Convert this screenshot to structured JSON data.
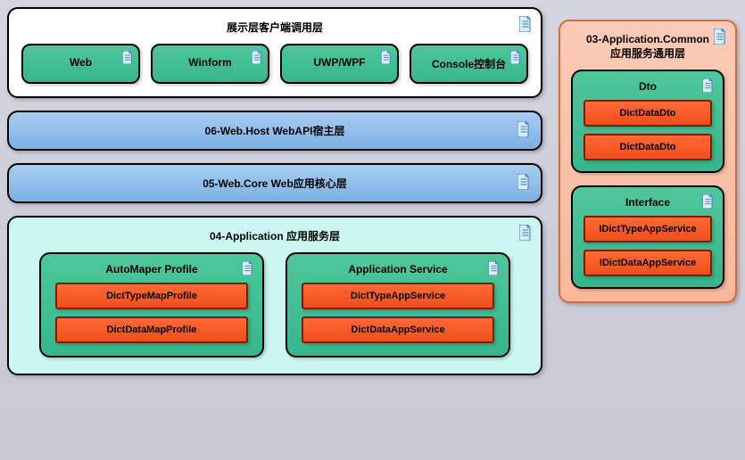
{
  "presentation": {
    "title": "展示层客户端调用层",
    "items": [
      {
        "label": "Web"
      },
      {
        "label": "Winform"
      },
      {
        "label": "UWP/WPF"
      },
      {
        "label": "Console控制台"
      }
    ]
  },
  "webHost": {
    "title": "06-Web.Host WebAPI宿主层"
  },
  "webCore": {
    "title": "05-Web.Core Web应用核心层"
  },
  "application": {
    "title": "04-Application 应用服务层",
    "automapper": {
      "title": "AutoMaper Profile",
      "items": [
        {
          "label": "DictTypeMapProfile"
        },
        {
          "label": "DictDataMapProfile"
        }
      ]
    },
    "service": {
      "title": "Application Service",
      "items": [
        {
          "label": "DictTypeAppService"
        },
        {
          "label": "DictDataAppService"
        }
      ]
    }
  },
  "common": {
    "title_line1": "03-Application.Common",
    "title_line2": "应用服务通用层",
    "dto": {
      "title": "Dto",
      "items": [
        {
          "label": "DictDataDto"
        },
        {
          "label": "DictDataDto"
        }
      ]
    },
    "interface": {
      "title": "Interface",
      "items": [
        {
          "label": "IDictTypeAppService"
        },
        {
          "label": "IDictDataAppService"
        }
      ]
    }
  }
}
